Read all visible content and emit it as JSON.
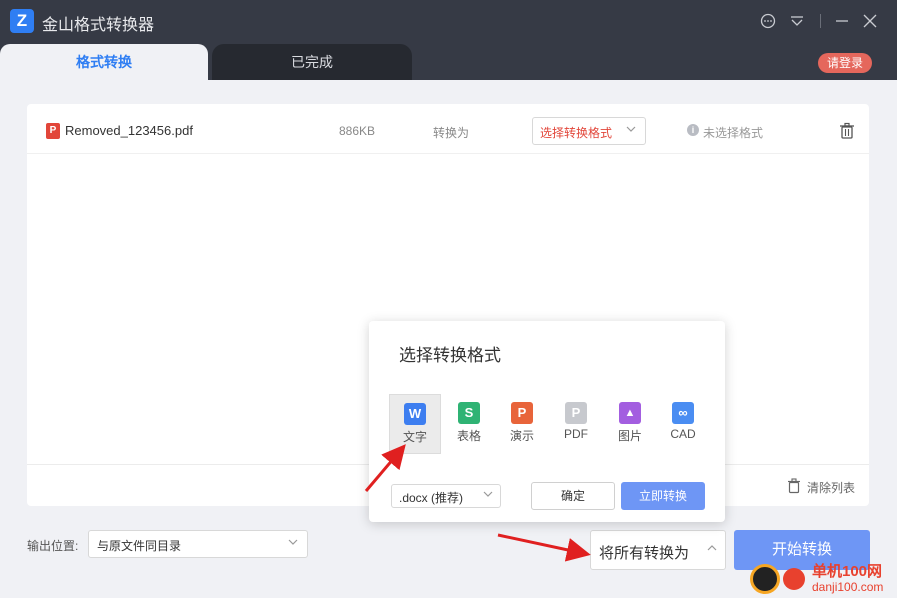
{
  "app": {
    "title": "金山格式转换器"
  },
  "tabs": [
    {
      "label": "格式转换"
    },
    {
      "label": "已完成"
    }
  ],
  "header": {
    "login_label": "请登录"
  },
  "file_list": {
    "rows": [
      {
        "icon": "pdf-icon",
        "name": "Removed_123456.pdf",
        "size": "886KB",
        "convert_to_label": "转换为",
        "format_select_placeholder": "选择转换格式",
        "status": "未选择格式"
      }
    ],
    "clear_label": "清除列表"
  },
  "output": {
    "label": "输出位置:",
    "value": "与原文件同目录"
  },
  "convert_all": {
    "label": "将所有转换为"
  },
  "start_button": {
    "label": "开始转换"
  },
  "popup": {
    "title": "选择转换格式",
    "formats": [
      {
        "glyph": "W",
        "label": "文字",
        "color": "#3d7ef0",
        "selected": true
      },
      {
        "glyph": "S",
        "label": "表格",
        "color": "#2fb374",
        "selected": false
      },
      {
        "glyph": "P",
        "label": "演示",
        "color": "#e8643a",
        "selected": false
      },
      {
        "glyph": "P",
        "label": "PDF",
        "color": "#c7c9ce",
        "selected": false
      },
      {
        "glyph": "▲",
        "label": "图片",
        "color": "#a35ee0",
        "selected": false
      },
      {
        "glyph": "∞",
        "label": "CAD",
        "color": "#4a8df2",
        "selected": false
      }
    ],
    "subformat_value": ".docx (推荐)",
    "confirm_label": "确定",
    "convert_now_label": "立即转换"
  },
  "watermark": {
    "text": "单机100网",
    "url": "danji100.com"
  },
  "colors": {
    "accent": "#2f7ef3",
    "titlebar": "#363a45",
    "danger": "#e2463a",
    "button": "#6e96f5"
  }
}
